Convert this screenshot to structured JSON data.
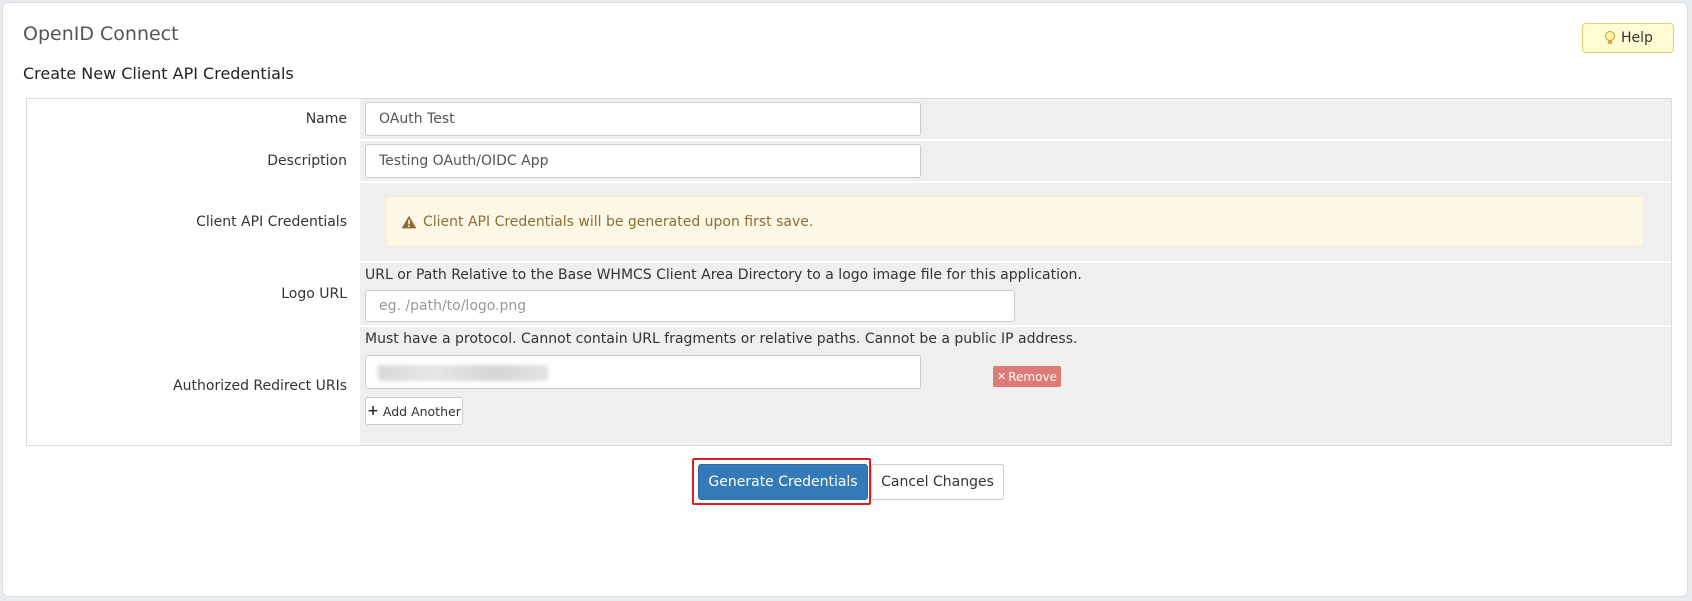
{
  "app": {
    "title": "OpenID Connect"
  },
  "help": {
    "label": "Help",
    "icon": "lightbulb-icon"
  },
  "section": {
    "title": "Create New Client API Credentials"
  },
  "form": {
    "name": {
      "label": "Name",
      "value": "OAuth Test"
    },
    "description": {
      "label": "Description",
      "value": "Testing OAuth/OIDC App"
    },
    "credentials": {
      "label": "Client API Credentials",
      "notice": "Client API Credentials will be generated upon first save.",
      "icon": "warning-icon"
    },
    "logo": {
      "label": "Logo URL",
      "help": "URL or Path Relative to the Base WHMCS Client Area Directory to a logo image file for this application.",
      "placeholder": "eg. /path/to/logo.png",
      "value": ""
    },
    "redirect": {
      "label": "Authorized Redirect URIs",
      "help": "Must have a protocol. Cannot contain URL fragments or relative paths. Cannot be a public IP address.",
      "remove_label": "Remove",
      "add_label": "Add Another"
    }
  },
  "actions": {
    "generate_label": "Generate Credentials",
    "cancel_label": "Cancel Changes"
  },
  "colors": {
    "primary": "#337ab7",
    "warning_bg": "#fcf8e3",
    "warning_text": "#8a6d3b",
    "remove": "#d9534f",
    "highlight": "#e02020"
  }
}
